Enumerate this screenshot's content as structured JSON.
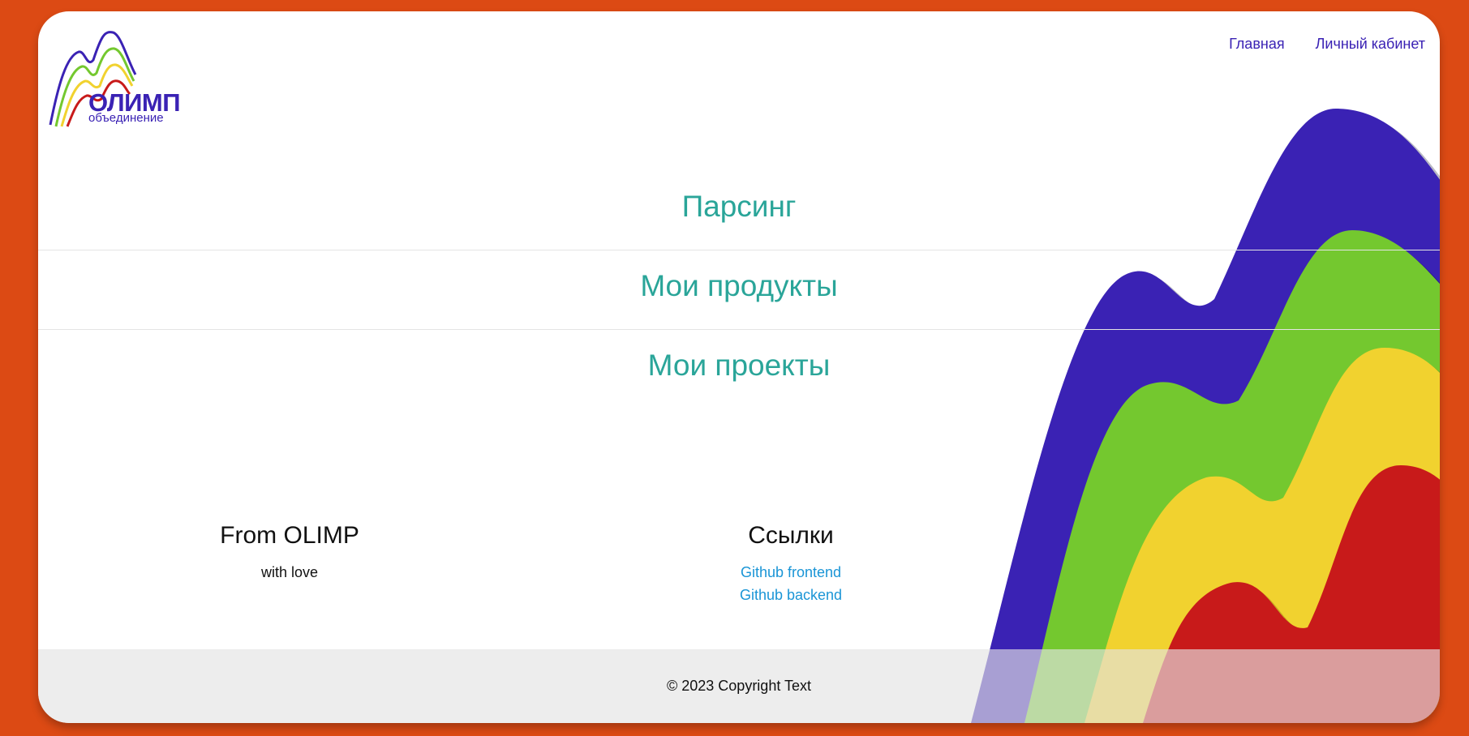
{
  "logo": {
    "title": "ОЛИМП",
    "subtitle": "объединение",
    "colors": [
      "#3a22b4",
      "#74c82f",
      "#f1d22f",
      "#c81a1a"
    ]
  },
  "nav": {
    "items": [
      {
        "label": "Главная"
      },
      {
        "label": "Личный кабинет"
      }
    ]
  },
  "main_menu": [
    {
      "label": "Парсинг"
    },
    {
      "label": "Мои продукты"
    },
    {
      "label": "Мои проекты"
    }
  ],
  "footer_columns": {
    "about": {
      "title": "From OLIMP",
      "text": "with love"
    },
    "links": {
      "title": "Ссылки",
      "items": [
        {
          "label": "Github frontend"
        },
        {
          "label": "Github backend"
        }
      ]
    }
  },
  "copyright": "© 2023 Copyright Text",
  "colors": {
    "background": "#dc4a14",
    "accent_teal": "#2aa599",
    "nav_link": "#3a22b4",
    "link_blue": "#1a95d6",
    "wave_purple": "#3a22b4",
    "wave_green": "#74c82f",
    "wave_yellow": "#f1d22f",
    "wave_red": "#c81a1a"
  }
}
